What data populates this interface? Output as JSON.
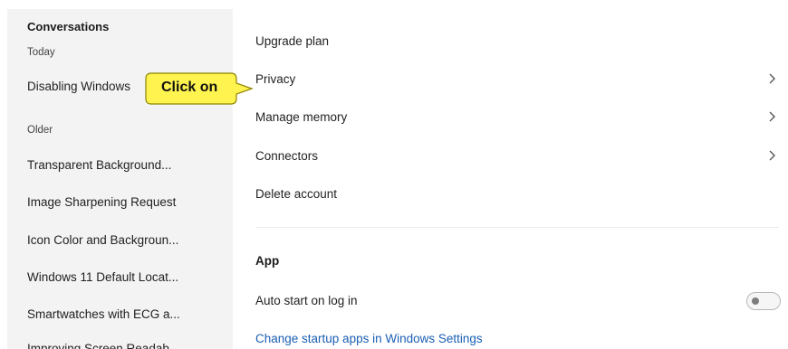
{
  "sidebar": {
    "heading": "Conversations",
    "today_label": "Today",
    "older_label": "Older",
    "today_items": [
      "Disabling Windows"
    ],
    "older_items": [
      "Transparent Background...",
      "Image Sharpening Request",
      "Icon Color and Backgroun...",
      "Windows 11 Default Locat...",
      "Smartwatches with ECG a...",
      "Improving Screen Readab..."
    ]
  },
  "settings": {
    "rows": [
      {
        "label": "Upgrade plan",
        "chevron": false
      },
      {
        "label": "Privacy",
        "chevron": true
      },
      {
        "label": "Manage memory",
        "chevron": true
      },
      {
        "label": "Connectors",
        "chevron": true
      },
      {
        "label": "Delete account",
        "chevron": false
      }
    ],
    "app_section": {
      "title": "App",
      "auto_start_label": "Auto start on log in",
      "auto_start_enabled": false,
      "startup_link": "Change startup apps in Windows Settings"
    }
  },
  "callout": {
    "text": "Click on",
    "fill_color": "#fff44f"
  },
  "colors": {
    "sidebar_bg": "#f3f3f3",
    "panel_bg": "#ffffff",
    "link": "#1a5fb4"
  }
}
